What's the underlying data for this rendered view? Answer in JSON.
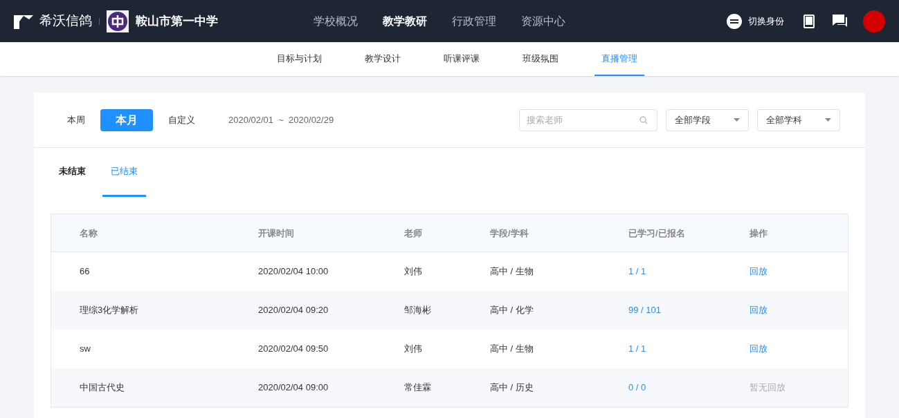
{
  "brand": {
    "name": "希沃信鸽",
    "school": "鞍山市第一中学"
  },
  "main_nav": [
    {
      "label": "学校概况",
      "selected": false
    },
    {
      "label": "教学教研",
      "selected": true
    },
    {
      "label": "行政管理",
      "selected": false
    },
    {
      "label": "资源中心",
      "selected": false
    }
  ],
  "switch_identity": "切换身份",
  "sub_nav": [
    {
      "label": "目标与计划",
      "selected": false
    },
    {
      "label": "教学设计",
      "selected": false
    },
    {
      "label": "听课评课",
      "selected": false
    },
    {
      "label": "班级氛围",
      "selected": false
    },
    {
      "label": "直播管理",
      "selected": true
    }
  ],
  "period_tabs": [
    {
      "label": "本周",
      "selected": false
    },
    {
      "label": "本月",
      "selected": true
    },
    {
      "label": "自定义",
      "selected": false
    }
  ],
  "date_range": "2020/02/01  ~  2020/02/29",
  "search": {
    "placeholder": "搜索老师"
  },
  "filters": [
    "全部学段",
    "全部学科"
  ],
  "status_tabs": [
    {
      "label": "未结束",
      "selected": false
    },
    {
      "label": "已结束",
      "selected": true
    }
  ],
  "table": {
    "columns": [
      "名称",
      "开课时间",
      "老师",
      "学段/学科",
      "已学习/已报名",
      "操作"
    ],
    "rows": [
      {
        "name": "66",
        "time": "2020/02/04 10:00",
        "teacher": "刘伟",
        "stage": "高中 / 生物",
        "count": "1 / 1",
        "action": "回放",
        "available": true
      },
      {
        "name": "理综3化学解析",
        "time": "2020/02/04 09:20",
        "teacher": "邹海彬",
        "stage": "高中 / 化学",
        "count": "99 / 101",
        "action": "回放",
        "available": true
      },
      {
        "name": "sw",
        "time": "2020/02/04 09:50",
        "teacher": "刘伟",
        "stage": "高中 / 生物",
        "count": "1 / 1",
        "action": "回放",
        "available": true
      },
      {
        "name": "中国古代史",
        "time": "2020/02/04 09:00",
        "teacher": "常佳霖",
        "stage": "高中 / 历史",
        "count": "0 / 0",
        "action": "暂无回放",
        "available": false
      }
    ]
  }
}
